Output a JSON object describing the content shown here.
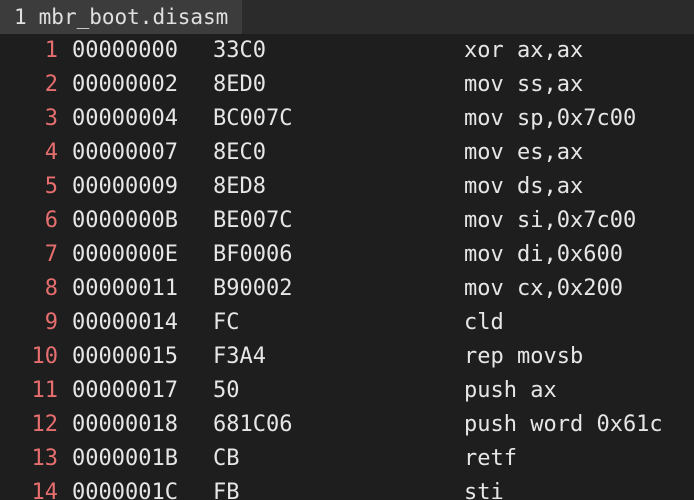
{
  "tab": {
    "index": "1",
    "filename": "mbr_boot.disasm"
  },
  "colors": {
    "background": "#1e1e1e",
    "tabbar": "#2b2b2b",
    "tab_active": "#3c3c3c",
    "line_number": "#e76e6e",
    "text": "#e6e6e6"
  },
  "lines": [
    {
      "num": "1",
      "addr": "00000000",
      "bytes": "33C0",
      "instr": "xor ax,ax"
    },
    {
      "num": "2",
      "addr": "00000002",
      "bytes": "8ED0",
      "instr": "mov ss,ax"
    },
    {
      "num": "3",
      "addr": "00000004",
      "bytes": "BC007C",
      "instr": "mov sp,0x7c00"
    },
    {
      "num": "4",
      "addr": "00000007",
      "bytes": "8EC0",
      "instr": "mov es,ax"
    },
    {
      "num": "5",
      "addr": "00000009",
      "bytes": "8ED8",
      "instr": "mov ds,ax"
    },
    {
      "num": "6",
      "addr": "0000000B",
      "bytes": "BE007C",
      "instr": "mov si,0x7c00"
    },
    {
      "num": "7",
      "addr": "0000000E",
      "bytes": "BF0006",
      "instr": "mov di,0x600"
    },
    {
      "num": "8",
      "addr": "00000011",
      "bytes": "B90002",
      "instr": "mov cx,0x200"
    },
    {
      "num": "9",
      "addr": "00000014",
      "bytes": "FC",
      "instr": "cld"
    },
    {
      "num": "10",
      "addr": "00000015",
      "bytes": "F3A4",
      "instr": "rep movsb"
    },
    {
      "num": "11",
      "addr": "00000017",
      "bytes": "50",
      "instr": "push ax"
    },
    {
      "num": "12",
      "addr": "00000018",
      "bytes": "681C06",
      "instr": "push word 0x61c"
    },
    {
      "num": "13",
      "addr": "0000001B",
      "bytes": "CB",
      "instr": "retf"
    },
    {
      "num": "14",
      "addr": "0000001C",
      "bytes": "FB",
      "instr": "sti"
    }
  ]
}
